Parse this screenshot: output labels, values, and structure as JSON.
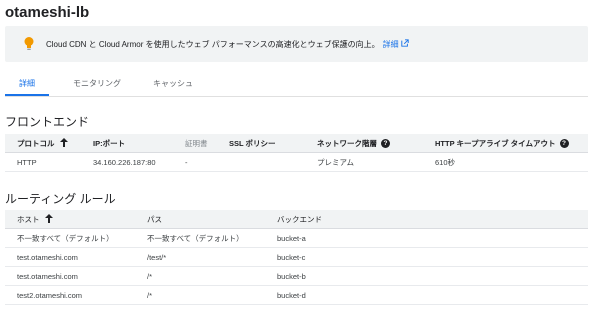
{
  "page": {
    "title": "otameshi-lb"
  },
  "banner": {
    "text": "Cloud CDN と Cloud Armor を使用したウェブ パフォーマンスの高速化とウェブ保護の向上。",
    "link_label": "詳細"
  },
  "tabs": [
    {
      "label": "詳細",
      "active": true
    },
    {
      "label": "モニタリング",
      "active": false
    },
    {
      "label": "キャッシュ",
      "active": false
    }
  ],
  "frontend": {
    "title": "フロントエンド",
    "columns": [
      "プロトコル",
      "IP:ポート",
      "証明書",
      "SSL ポリシー",
      "ネットワーク階層",
      "HTTP キープアライブ タイムアウト"
    ],
    "rows": [
      [
        "HTTP",
        "34.160.226.187:80",
        "-",
        "",
        "プレミアム",
        "610秒"
      ]
    ]
  },
  "routing": {
    "title": "ルーティング ルール",
    "columns": [
      "ホスト",
      "パス",
      "バックエンド"
    ],
    "rows": [
      [
        "不一致すべて（デフォルト）",
        "不一致すべて（デフォルト）",
        "bucket-a"
      ],
      [
        "test.otameshi.com",
        "/test/*",
        "bucket-c"
      ],
      [
        "test.otameshi.com",
        "/*",
        "bucket-b"
      ],
      [
        "test2.otameshi.com",
        "/*",
        "bucket-d"
      ]
    ]
  },
  "colors": {
    "accent": "#1a73e8",
    "bulb": "#f29900",
    "header_bg": "#f1f3f4"
  }
}
